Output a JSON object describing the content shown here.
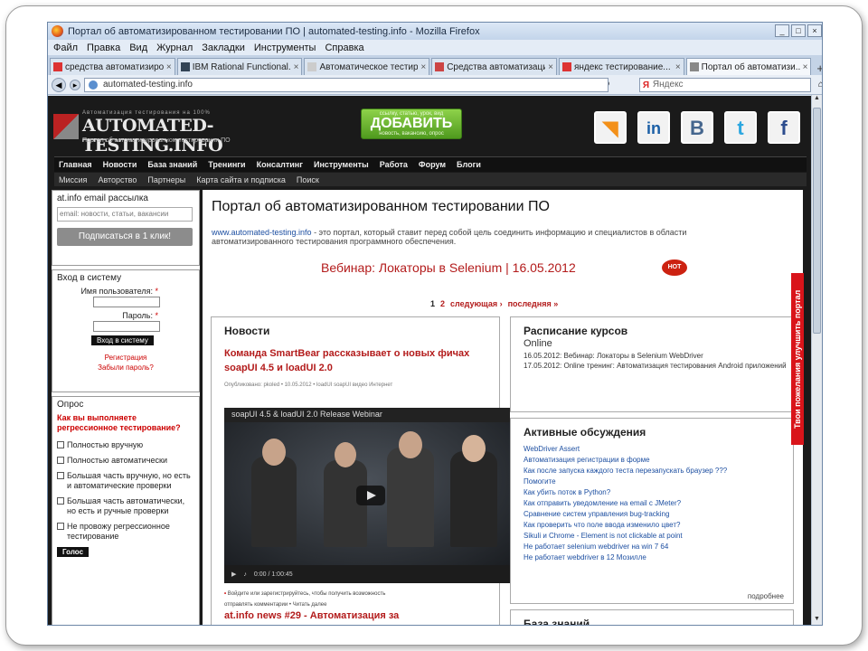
{
  "window": {
    "title": "Портал об автоматизированном тестировании ПО | automated-testing.info - Mozilla Firefox",
    "buttons": [
      "_",
      "□",
      "×"
    ]
  },
  "menu": [
    "Файл",
    "Правка",
    "Вид",
    "Журнал",
    "Закладки",
    "Инструменты",
    "Справка"
  ],
  "tabs": [
    {
      "label": "средства автоматизирования..."
    },
    {
      "label": "IBM Rational Functional..."
    },
    {
      "label": "Автоматическое тестирование..."
    },
    {
      "label": "Средства автоматизации..."
    },
    {
      "label": "яндекс тестирование..."
    },
    {
      "label": "Портал об автоматизи..."
    }
  ],
  "tab_new": "+",
  "nav": {
    "url": "automated-testing.info",
    "search_placeholder": "Яндекс",
    "search_logo": "Я"
  },
  "site": {
    "logo_tag": "Автоматизация тестирования на 100%",
    "logo_big": "AUTOMATED-TESTING.INFO",
    "logo_sub": "Портал об автоматизированном тестировании ПО",
    "add_small1": "ссылку, статью, урок, вид",
    "add_main": "ДОБАВИТЬ",
    "add_small2": "новость, вакансию, опрос",
    "social": [
      {
        "icon": "rss-icon",
        "glyph": "◥",
        "color": "#f39019"
      },
      {
        "icon": "linkedin-icon",
        "glyph": "in",
        "color": "#1b5fa6"
      },
      {
        "icon": "vkontakte-icon",
        "glyph": "B",
        "color": "#45668e"
      },
      {
        "icon": "twitter-icon",
        "glyph": "t",
        "color": "#2ca7e0"
      },
      {
        "icon": "facebook-icon",
        "glyph": "f",
        "color": "#2d4d8e"
      }
    ],
    "main_nav": [
      "Главная",
      "Новости",
      "База знаний",
      "Тренинги",
      "Консалтинг",
      "Инструменты",
      "Работа",
      "Форум",
      "Блоги"
    ],
    "sub_nav": [
      "Миссия",
      "Авторство",
      "Партнеры",
      "Карта сайта и подписка",
      "Поиск"
    ]
  },
  "sidebar": {
    "mail_title": "at.info email рассылка",
    "mail_placeholder": "email: новости, статьи, вакансии",
    "mail_button": "Подписаться в 1 клик!",
    "login_title": "Вход в систему",
    "user_label": "Имя пользователя:",
    "pass_label": "Пароль:",
    "required_mark": "*",
    "login_button": "Вход в систему",
    "register": "Регистрация",
    "forgot": "Забыли пароль?",
    "poll_title": "Опрос",
    "poll_question": "Как вы выполняете регрессионное тестирование?",
    "poll_options": [
      "Полностью вручную",
      "Полностью автоматически",
      "Большая часть вручную, но есть и автоматические проверки",
      "Большая часть автоматически, но есть и ручные проверки",
      "Не провожу регрессионное тестирование"
    ],
    "vote": "Голос"
  },
  "content": {
    "title": "Портал об автоматизированном тестировании ПО",
    "intro_link": "www.automated-testing.info",
    "intro_text": " - это портал, который ставит перед собой цель соединить информацию и специалистов в области автоматизированного тестирования программного обеспечения.",
    "webinar": "Вебинар: Локаторы в Selenium | 16.05.2012",
    "hot": "HOT",
    "pager": {
      "p1": "1",
      "p2": "2",
      "next": "следующая ›",
      "last": "последняя »"
    },
    "news_title": "Новости",
    "news_item_title": "Команда SmartBear рассказывает о новых фичах soapUI 4.5 и loadUI 2.0",
    "news_meta": "Опубликовано: pkoled • 10.05.2012 • loadUI soapUI видео Интернет",
    "video_title": "soapUI 4.5 & loadUI 2.0 Release Webinar",
    "video_time": "0:00 / 1:00:45",
    "news_foot1": "Войдите или зарегистрируйтесь, чтобы получить возможность",
    "news_foot2": "отправлять комментарии • Читать далее",
    "news2_title": "at.info news #29 - Автоматизация за",
    "sched_title": "Расписание курсов",
    "sched_online": "Online",
    "sched_lines": [
      "16.05.2012: Вебинар: Локаторы в Selenium WebDriver",
      "17.05.2012: Online тренинг: Автоматизация тестирования Android приложений"
    ],
    "disc_title": "Активные обсуждения",
    "disc_links": [
      "WebDriver Assert",
      "Автоматизация регистрации в форме",
      "Как после запуска каждого теста перезапускать браузер ???",
      "Помогите",
      "Как убить поток в Python?",
      "Как отправить уведомление на email с JMeter?",
      "Сравнение систем управления bug-tracking",
      "Как проверить что поле ввода изменило цвет?",
      "Sikuli и Chrome - Element is not clickable at point",
      "Не работает selenium webdriver на win 7 64",
      "Не работает webdriver в 12 Мозилле"
    ],
    "disc_more": "подробнее",
    "kb_title": "База знаний"
  },
  "feedback": "Твои пожелания улучшить портал"
}
